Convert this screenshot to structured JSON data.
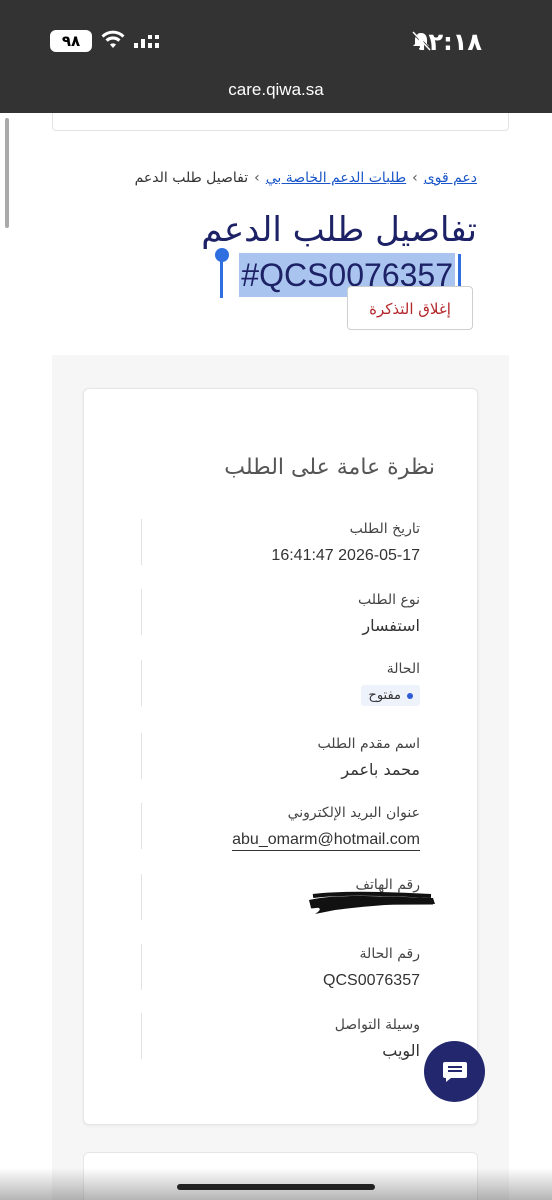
{
  "status_bar": {
    "time": "١٢:١٨",
    "battery": "٩٨"
  },
  "browser": {
    "url": "care.qiwa.sa"
  },
  "breadcrumb": {
    "home": "دعم قوى",
    "requests": "طلبات الدعم الخاصة بي",
    "current": "تفاصيل طلب الدعم"
  },
  "page": {
    "title": "تفاصيل طلب الدعم",
    "ticket_id": "#QCS0076357",
    "close_ticket_label": "إغلاق التذكرة"
  },
  "overview": {
    "heading": "نظرة عامة على الطلب",
    "fields": {
      "request_date_label": "تاريخ الطلب",
      "request_date_value": "16:41:47 2026-05-17",
      "request_type_label": "نوع الطلب",
      "request_type_value": "استفسار",
      "status_label": "الحالة",
      "status_value": "مفتوح",
      "requester_label": "اسم مقدم الطلب",
      "requester_value": "محمد باعمر",
      "email_label": "عنوان البريد الإلكتروني",
      "email_value": "abu_omarm@hotmail.com",
      "phone_label": "رقم الهاتف",
      "case_number_label": "رقم الحالة",
      "case_number_value": "QCS0076357",
      "contact_method_label": "وسيلة التواصل",
      "contact_method_value": "الويب"
    }
  },
  "colors": {
    "title": "#1d2166",
    "link": "#1a56c8",
    "close_button_text": "#b3262b",
    "chat_button": "#23286e",
    "status_dot": "#2f5bd6"
  }
}
